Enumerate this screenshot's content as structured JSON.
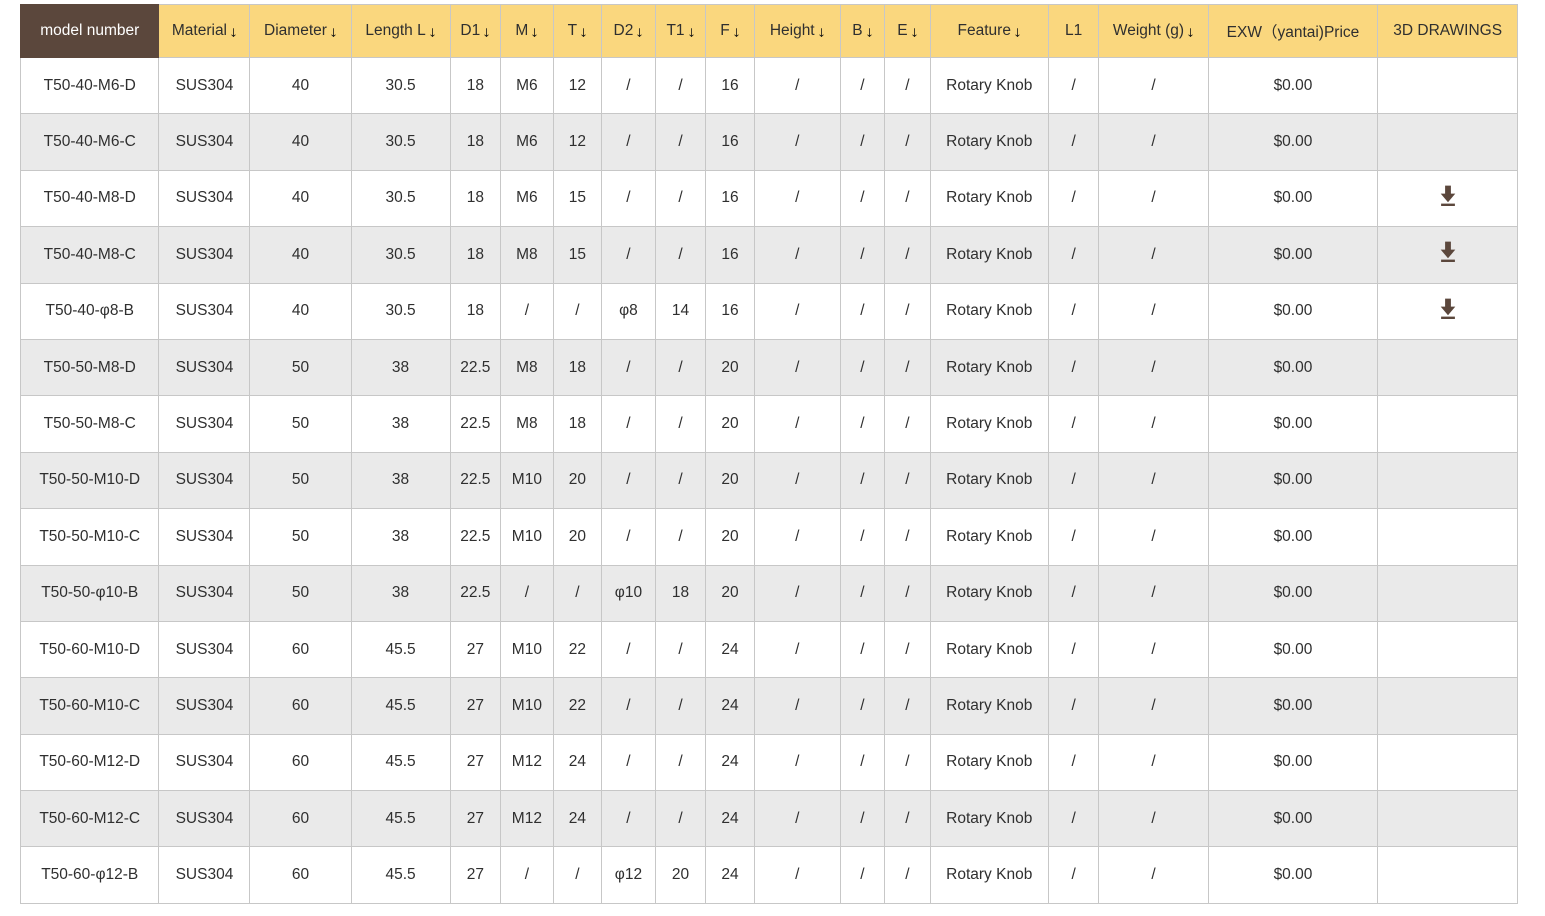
{
  "table": {
    "columns": [
      {
        "key": "model",
        "label": "model number",
        "sortable": false,
        "accent": "dark"
      },
      {
        "key": "mat",
        "label": "Material",
        "sortable": true
      },
      {
        "key": "dia",
        "label": "Diameter",
        "sortable": true
      },
      {
        "key": "len",
        "label": "Length L",
        "sortable": true
      },
      {
        "key": "d1",
        "label": "D1",
        "sortable": true
      },
      {
        "key": "m",
        "label": "M",
        "sortable": true
      },
      {
        "key": "t",
        "label": "T",
        "sortable": true
      },
      {
        "key": "d2",
        "label": "D2",
        "sortable": true
      },
      {
        "key": "t1",
        "label": "T1",
        "sortable": true
      },
      {
        "key": "f",
        "label": "F",
        "sortable": true
      },
      {
        "key": "height",
        "label": "Height",
        "sortable": true
      },
      {
        "key": "b",
        "label": "B",
        "sortable": true
      },
      {
        "key": "e",
        "label": "E",
        "sortable": true
      },
      {
        "key": "feature",
        "label": "Feature",
        "sortable": true
      },
      {
        "key": "l1",
        "label": "L1",
        "sortable": false
      },
      {
        "key": "weight",
        "label": "Weight (g)",
        "sortable": true
      },
      {
        "key": "price",
        "label": "EXW（yantai)Price",
        "sortable": false
      },
      {
        "key": "drawing",
        "label": "3D DRAWINGS",
        "sortable": false
      }
    ],
    "sort_arrow_glyph": "↓",
    "download_icon_name": "download-icon",
    "rows": [
      {
        "model": "T50-40-M6-D",
        "mat": "SUS304",
        "dia": "40",
        "len": "30.5",
        "d1": "18",
        "m": "M6",
        "t": "12",
        "d2": "/",
        "t1": "/",
        "f": "16",
        "height": "/",
        "b": "/",
        "e": "/",
        "feature": "Rotary Knob",
        "l1": "/",
        "weight": "/",
        "price": "$0.00",
        "drawing": false
      },
      {
        "model": "T50-40-M6-C",
        "mat": "SUS304",
        "dia": "40",
        "len": "30.5",
        "d1": "18",
        "m": "M6",
        "t": "12",
        "d2": "/",
        "t1": "/",
        "f": "16",
        "height": "/",
        "b": "/",
        "e": "/",
        "feature": "Rotary Knob",
        "l1": "/",
        "weight": "/",
        "price": "$0.00",
        "drawing": false
      },
      {
        "model": "T50-40-M8-D",
        "mat": "SUS304",
        "dia": "40",
        "len": "30.5",
        "d1": "18",
        "m": "M6",
        "t": "15",
        "d2": "/",
        "t1": "/",
        "f": "16",
        "height": "/",
        "b": "/",
        "e": "/",
        "feature": "Rotary Knob",
        "l1": "/",
        "weight": "/",
        "price": "$0.00",
        "drawing": true
      },
      {
        "model": "T50-40-M8-C",
        "mat": "SUS304",
        "dia": "40",
        "len": "30.5",
        "d1": "18",
        "m": "M8",
        "t": "15",
        "d2": "/",
        "t1": "/",
        "f": "16",
        "height": "/",
        "b": "/",
        "e": "/",
        "feature": "Rotary Knob",
        "l1": "/",
        "weight": "/",
        "price": "$0.00",
        "drawing": true
      },
      {
        "model": "T50-40-φ8-B",
        "mat": "SUS304",
        "dia": "40",
        "len": "30.5",
        "d1": "18",
        "m": "/",
        "t": "/",
        "d2": "φ8",
        "t1": "14",
        "f": "16",
        "height": "/",
        "b": "/",
        "e": "/",
        "feature": "Rotary Knob",
        "l1": "/",
        "weight": "/",
        "price": "$0.00",
        "drawing": true
      },
      {
        "model": "T50-50-M8-D",
        "mat": "SUS304",
        "dia": "50",
        "len": "38",
        "d1": "22.5",
        "m": "M8",
        "t": "18",
        "d2": "/",
        "t1": "/",
        "f": "20",
        "height": "/",
        "b": "/",
        "e": "/",
        "feature": "Rotary Knob",
        "l1": "/",
        "weight": "/",
        "price": "$0.00",
        "drawing": false
      },
      {
        "model": "T50-50-M8-C",
        "mat": "SUS304",
        "dia": "50",
        "len": "38",
        "d1": "22.5",
        "m": "M8",
        "t": "18",
        "d2": "/",
        "t1": "/",
        "f": "20",
        "height": "/",
        "b": "/",
        "e": "/",
        "feature": "Rotary Knob",
        "l1": "/",
        "weight": "/",
        "price": "$0.00",
        "drawing": false
      },
      {
        "model": "T50-50-M10-D",
        "mat": "SUS304",
        "dia": "50",
        "len": "38",
        "d1": "22.5",
        "m": "M10",
        "t": "20",
        "d2": "/",
        "t1": "/",
        "f": "20",
        "height": "/",
        "b": "/",
        "e": "/",
        "feature": "Rotary Knob",
        "l1": "/",
        "weight": "/",
        "price": "$0.00",
        "drawing": false
      },
      {
        "model": "T50-50-M10-C",
        "mat": "SUS304",
        "dia": "50",
        "len": "38",
        "d1": "22.5",
        "m": "M10",
        "t": "20",
        "d2": "/",
        "t1": "/",
        "f": "20",
        "height": "/",
        "b": "/",
        "e": "/",
        "feature": "Rotary Knob",
        "l1": "/",
        "weight": "/",
        "price": "$0.00",
        "drawing": false
      },
      {
        "model": "T50-50-φ10-B",
        "mat": "SUS304",
        "dia": "50",
        "len": "38",
        "d1": "22.5",
        "m": "/",
        "t": "/",
        "d2": "φ10",
        "t1": "18",
        "f": "20",
        "height": "/",
        "b": "/",
        "e": "/",
        "feature": "Rotary Knob",
        "l1": "/",
        "weight": "/",
        "price": "$0.00",
        "drawing": false
      },
      {
        "model": "T50-60-M10-D",
        "mat": "SUS304",
        "dia": "60",
        "len": "45.5",
        "d1": "27",
        "m": "M10",
        "t": "22",
        "d2": "/",
        "t1": "/",
        "f": "24",
        "height": "/",
        "b": "/",
        "e": "/",
        "feature": "Rotary Knob",
        "l1": "/",
        "weight": "/",
        "price": "$0.00",
        "drawing": false
      },
      {
        "model": "T50-60-M10-C",
        "mat": "SUS304",
        "dia": "60",
        "len": "45.5",
        "d1": "27",
        "m": "M10",
        "t": "22",
        "d2": "/",
        "t1": "/",
        "f": "24",
        "height": "/",
        "b": "/",
        "e": "/",
        "feature": "Rotary Knob",
        "l1": "/",
        "weight": "/",
        "price": "$0.00",
        "drawing": false
      },
      {
        "model": "T50-60-M12-D",
        "mat": "SUS304",
        "dia": "60",
        "len": "45.5",
        "d1": "27",
        "m": "M12",
        "t": "24",
        "d2": "/",
        "t1": "/",
        "f": "24",
        "height": "/",
        "b": "/",
        "e": "/",
        "feature": "Rotary Knob",
        "l1": "/",
        "weight": "/",
        "price": "$0.00",
        "drawing": false
      },
      {
        "model": "T50-60-M12-C",
        "mat": "SUS304",
        "dia": "60",
        "len": "45.5",
        "d1": "27",
        "m": "M12",
        "t": "24",
        "d2": "/",
        "t1": "/",
        "f": "24",
        "height": "/",
        "b": "/",
        "e": "/",
        "feature": "Rotary Knob",
        "l1": "/",
        "weight": "/",
        "price": "$0.00",
        "drawing": false
      },
      {
        "model": "T50-60-φ12-B",
        "mat": "SUS304",
        "dia": "60",
        "len": "45.5",
        "d1": "27",
        "m": "/",
        "t": "/",
        "d2": "φ12",
        "t1": "20",
        "f": "24",
        "height": "/",
        "b": "/",
        "e": "/",
        "feature": "Rotary Knob",
        "l1": "/",
        "weight": "/",
        "price": "$0.00",
        "drawing": false
      }
    ]
  },
  "colors": {
    "header_accent": "#fad77e",
    "header_first_col": "#5b473c",
    "row_stripe": "#eaeaea",
    "row_base": "#ffffff",
    "icon": "#5b473c",
    "border": "#c7c7c7"
  }
}
